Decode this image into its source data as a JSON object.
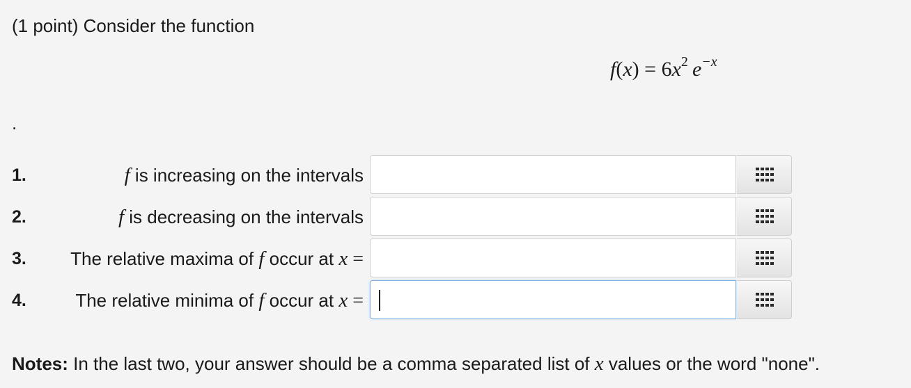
{
  "problem": {
    "intro": "(1 point) Consider the function",
    "formula": {
      "f": "f",
      "lparen": "(",
      "x": "x",
      "rparen": ")",
      "equals": " = ",
      "coeff": "6",
      "x2": "x",
      "exp2": "2",
      "e": "e",
      "exp_neg_x": "−x"
    },
    "period": "."
  },
  "questions": [
    {
      "number": "1.",
      "pre": "",
      "f": "f",
      "post": " is increasing on the intervals",
      "value": "",
      "focused": false
    },
    {
      "number": "2.",
      "pre": "",
      "f": "f",
      "post": " is decreasing on the intervals",
      "value": "",
      "focused": false
    },
    {
      "number": "3.",
      "pre": "The relative maxima of ",
      "f": "f",
      "post": " occur at ",
      "x": "x",
      "eq": " =",
      "value": "",
      "focused": false
    },
    {
      "number": "4.",
      "pre": "The relative minima of ",
      "f": "f",
      "post": " occur at ",
      "x": "x",
      "eq": " =",
      "value": "",
      "focused": true
    }
  ],
  "palette_icon": "grid-icon",
  "notes": {
    "bold": "Notes:",
    "text1": " In the last two, your answer should be a comma separated list of ",
    "x": "x",
    "text2": " values or the word \"none\"."
  },
  "colors": {
    "background": "#f4f4f4",
    "focus_border": "#7fb4e5"
  }
}
